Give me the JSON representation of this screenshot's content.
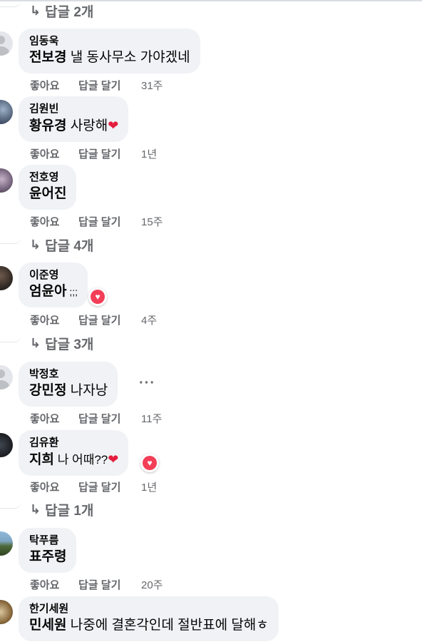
{
  "comments": [
    {
      "author": "임동욱",
      "tag": "전보경",
      "text": " 낼 동사무소 가야겠네",
      "like": "좋아요",
      "reply": "답글 달기",
      "time": "31주"
    },
    {
      "author": "김원빈",
      "tag": "황유경",
      "text": " 사랑해",
      "like": "좋아요",
      "reply": "답글 달기",
      "time": "1년"
    },
    {
      "author": "전호영",
      "tag": "윤어진",
      "text": "",
      "like": "좋아요",
      "reply": "답글 달기",
      "time": "15주"
    },
    {
      "author": "이준영",
      "tag": "엄윤아",
      "text": " ;;;",
      "like": "좋아요",
      "reply": "답글 달기",
      "time": "4주"
    },
    {
      "author": "박정호",
      "tag": "강민정",
      "text": " 나자낭",
      "like": "좋아요",
      "reply": "답글 달기",
      "time": "11주"
    },
    {
      "author": "김유환",
      "tag": "지희",
      "text": " 나 어때??",
      "like": "좋아요",
      "reply": "답글 달기",
      "time": "1년"
    },
    {
      "author": "탁푸름",
      "tag": "표주령",
      "text": "",
      "like": "좋아요",
      "reply": "답글 달기",
      "time": "20주"
    },
    {
      "author": "한기세원",
      "tag": "민세원",
      "text": " 나중에 결혼각인데 절반표에 달해ㅎ"
    }
  ],
  "replies": [
    {
      "label": "답글 2개"
    },
    {
      "label": "답글 4개"
    },
    {
      "label": "답글 3개"
    },
    {
      "label": "답글 1개"
    }
  ],
  "more_label": "···",
  "colors": {
    "bubble": "#f0f2f5",
    "meta": "#65676b",
    "heart": "#e41e3f",
    "reaction": "#f33e58"
  }
}
